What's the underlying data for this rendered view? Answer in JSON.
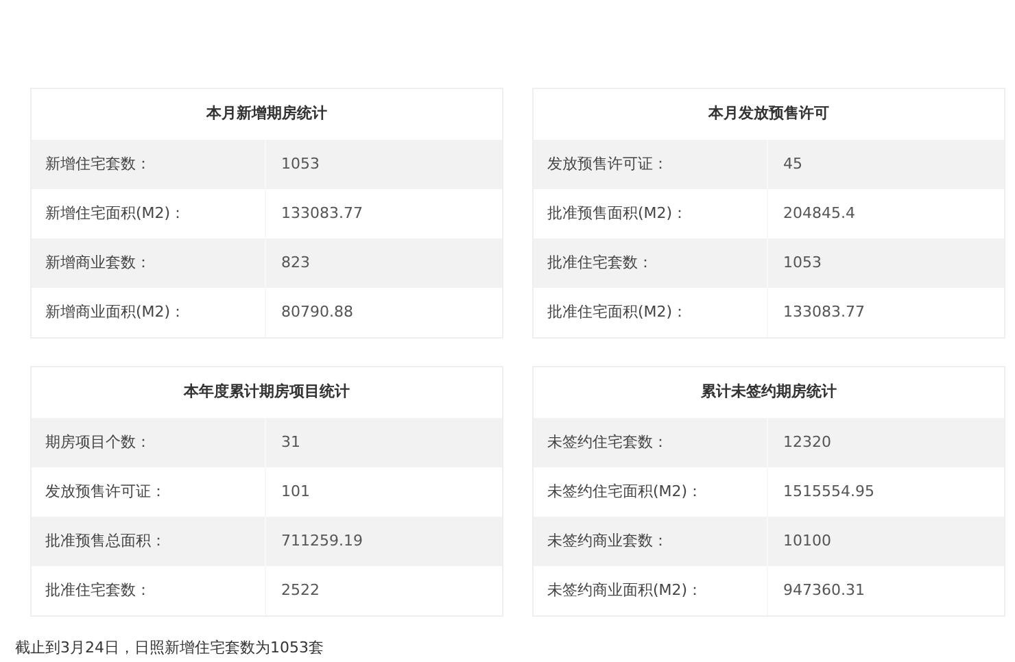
{
  "panels": [
    {
      "title": "本月新增期房统计",
      "rows": [
        {
          "label": "新增住宅套数：",
          "value": "1053"
        },
        {
          "label": "新增住宅面积(M2)：",
          "value": "133083.77"
        },
        {
          "label": "新增商业套数：",
          "value": "823"
        },
        {
          "label": "新增商业面积(M2)：",
          "value": "80790.88"
        }
      ]
    },
    {
      "title": "本月发放预售许可",
      "rows": [
        {
          "label": "发放预售许可证：",
          "value": "45"
        },
        {
          "label": "批准预售面积(M2)：",
          "value": "204845.4"
        },
        {
          "label": "批准住宅套数：",
          "value": "1053"
        },
        {
          "label": "批准住宅面积(M2)：",
          "value": "133083.77"
        }
      ]
    },
    {
      "title": "本年度累计期房项目统计",
      "rows": [
        {
          "label": "期房项目个数：",
          "value": "31"
        },
        {
          "label": "发放预售许可证：",
          "value": "101"
        },
        {
          "label": "批准预售总面积：",
          "value": "711259.19"
        },
        {
          "label": "批准住宅套数：",
          "value": "2522"
        }
      ]
    },
    {
      "title": "累计未签约期房统计",
      "rows": [
        {
          "label": "未签约住宅套数：",
          "value": "12320"
        },
        {
          "label": "未签约住宅面积(M2)：",
          "value": "1515554.95"
        },
        {
          "label": "未签约商业套数：",
          "value": "10100"
        },
        {
          "label": "未签约商业面积(M2)：",
          "value": "947360.31"
        }
      ]
    }
  ],
  "caption": "截止到3月24日，日照新增住宅套数为1053套"
}
